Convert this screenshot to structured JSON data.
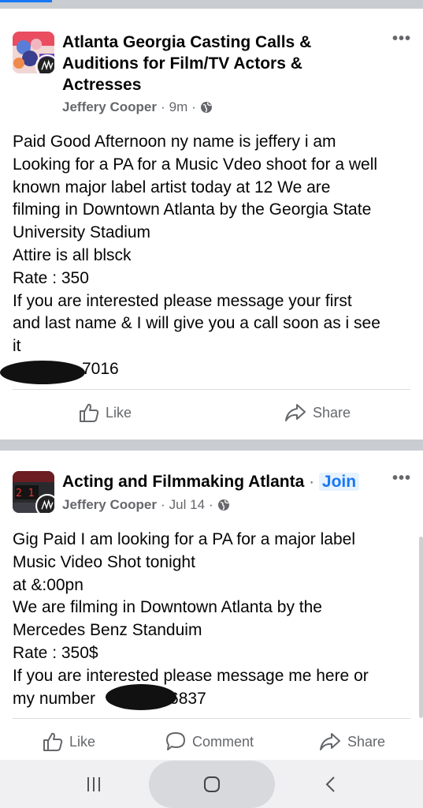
{
  "colors": {
    "link_blue": "#1877f2",
    "meta_grey": "#65676b",
    "separator": "#c9ccd1"
  },
  "post1": {
    "group_name_lines": [
      "Atlanta Georgia Casting Calls &",
      "Auditions for Film/TV Actors &",
      "Actresses"
    ],
    "author": "Jeffery Cooper",
    "time": "9m",
    "visibility_icon": "globe-icon",
    "menu_icon": "more-options-icon",
    "body_lines": [
      "Paid  Good Afternoon ny name is jeffery i am",
      "Looking for a PA for a Music Vdeo shoot for a well",
      "known major label artist today at 12 We are",
      "filming in Downtown Atlanta by the Georgia State",
      "University Stadium",
      "Attire is  all blsck",
      "Rate : 350",
      "If you are interested please message your first",
      "and last name & I will give you a call soon as i see",
      "it"
    ],
    "phone_visible_suffix": "7016",
    "actions": {
      "like": "Like",
      "share": "Share"
    }
  },
  "post2": {
    "group_name": "Acting and Filmmaking Atlanta",
    "join_label": "Join",
    "author": "Jeffery Cooper",
    "time": "Jul 14",
    "visibility_icon": "globe-icon",
    "menu_icon": "more-options-icon",
    "body_lines": [
      "Gig Paid I am looking for a PA for a major label",
      "Music Video Shot  tonight",
      "at &:00pn",
      "We are filming in Downtown Atlanta by the",
      "Mercedes Benz Standuim",
      "Rate : 350$",
      "If you are interested please message me here or"
    ],
    "last_line_prefix": "my number",
    "phone_visible_suffix": "6837",
    "actions": {
      "like": "Like",
      "comment": "Comment",
      "share": "Share"
    }
  },
  "system_nav": {
    "recents_icon": "recents-icon",
    "home_icon": "home-icon",
    "back_icon": "back-icon"
  }
}
